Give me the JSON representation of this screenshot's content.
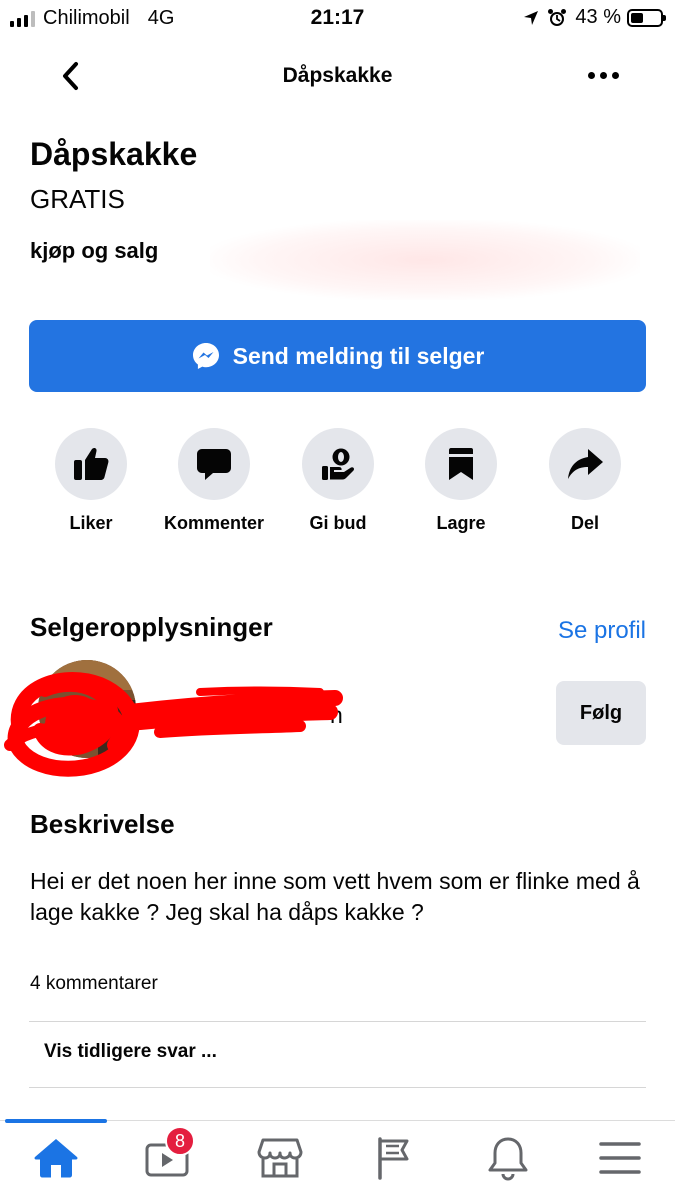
{
  "status_bar": {
    "carrier": "Chilimobil",
    "network": "4G",
    "time": "21:17",
    "battery": "43 %",
    "battery_level": 0.43
  },
  "nav": {
    "title": "Dåpskakke"
  },
  "listing": {
    "title": "Dåpskakke",
    "price": "GRATIS",
    "group": "kjøp og salg"
  },
  "send_button": {
    "label": "Send melding til selger"
  },
  "actions": [
    {
      "label": "Liker",
      "icon": "thumbs-up-icon"
    },
    {
      "label": "Kommenter",
      "icon": "comment-icon"
    },
    {
      "label": "Gi bud",
      "icon": "offer-icon"
    },
    {
      "label": "Lagre",
      "icon": "bookmark-icon"
    },
    {
      "label": "Del",
      "icon": "share-icon"
    }
  ],
  "seller": {
    "section_title": "Selgeropplysninger",
    "see_profile": "Se profil",
    "name_visible": "n",
    "follow": "Følg"
  },
  "description": {
    "title": "Beskrivelse",
    "text": "Hei er det noen her inne som vett hvem som er flinke med å lage kakke ? Jeg skal ha dåps kakke ?"
  },
  "comments": {
    "count_label": "4 kommentarer",
    "earlier_replies": "Vis tidligere svar ..."
  },
  "tab_bar": {
    "video_badge": "8",
    "tabs": [
      "home-icon",
      "video-icon",
      "marketplace-icon",
      "pages-flag-icon",
      "bell-icon",
      "menu-icon"
    ]
  },
  "colors": {
    "accent": "#2374e1",
    "link": "#1b74e4",
    "button_gray": "#e4e6eb",
    "badge": "#e41e3f",
    "redaction": "#ff0000"
  }
}
